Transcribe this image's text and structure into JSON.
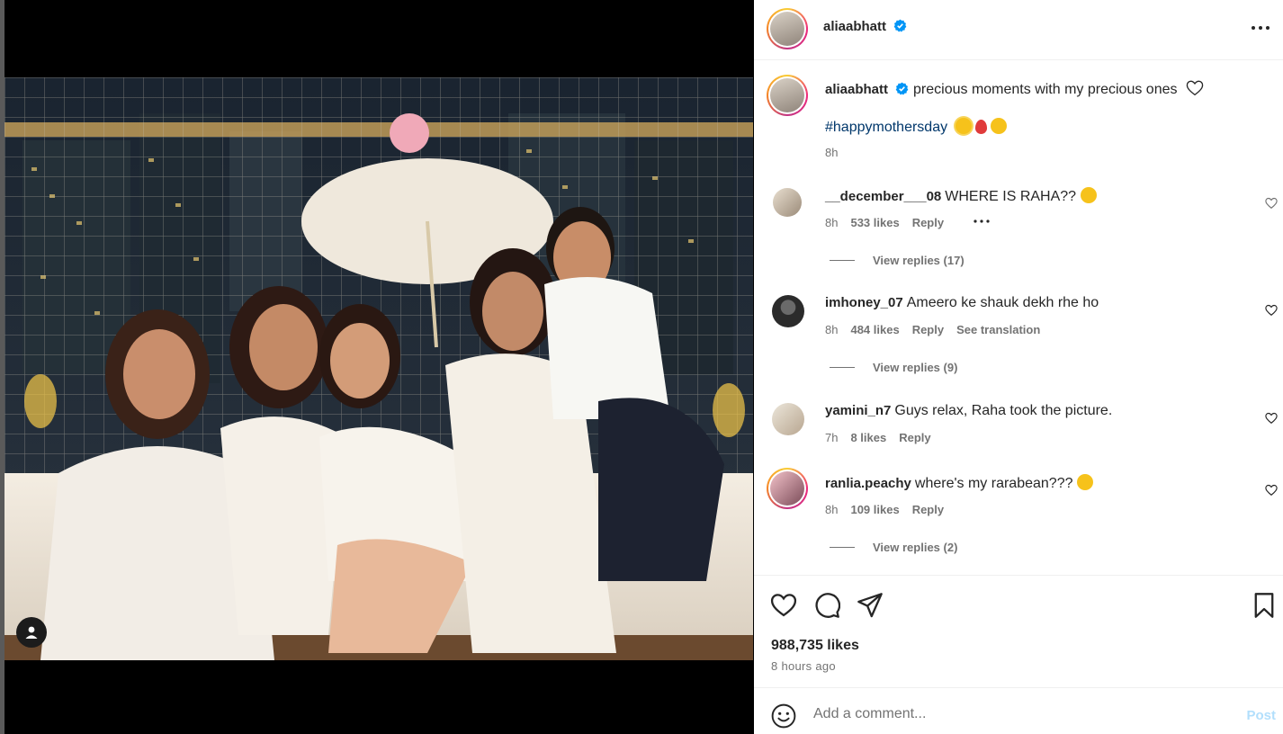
{
  "post": {
    "author": "aliaabhatt",
    "caption": "precious moments with my precious ones",
    "hashtag": "#happymothersday",
    "caption_time": "8h",
    "likes": "988,735 likes",
    "time_ago": "8 hours ago"
  },
  "comments": [
    {
      "username": "__december___08",
      "text": "WHERE IS RAHA??",
      "time": "8h",
      "likes": "533 likes",
      "reply": "Reply",
      "view_replies": "View replies (17)"
    },
    {
      "username": "imhoney_07",
      "text": "Ameero ke shauk dekh rhe ho",
      "time": "8h",
      "likes": "484 likes",
      "reply": "Reply",
      "see_translation": "See translation",
      "view_replies": "View replies (9)"
    },
    {
      "username": "yamini_n7",
      "text": "Guys relax, Raha took the picture.",
      "time": "7h",
      "likes": "8 likes",
      "reply": "Reply"
    },
    {
      "username": "ranlia.peachy",
      "text": "where's my rarabean???",
      "time": "8h",
      "likes": "109 likes",
      "reply": "Reply",
      "view_replies": "View replies (2)"
    }
  ],
  "comment_box": {
    "placeholder": "Add a comment...",
    "post_label": "Post"
  },
  "icons": [
    "verified-badge-icon",
    "more-options-icon",
    "heart-icon",
    "comment-icon",
    "share-icon",
    "bookmark-icon",
    "emoji-icon",
    "tag-user-icon"
  ],
  "colors": {
    "verified": "#0095f6",
    "hashtag": "#00376b",
    "post_disabled": "#b2dffc",
    "muted": "#737373"
  }
}
